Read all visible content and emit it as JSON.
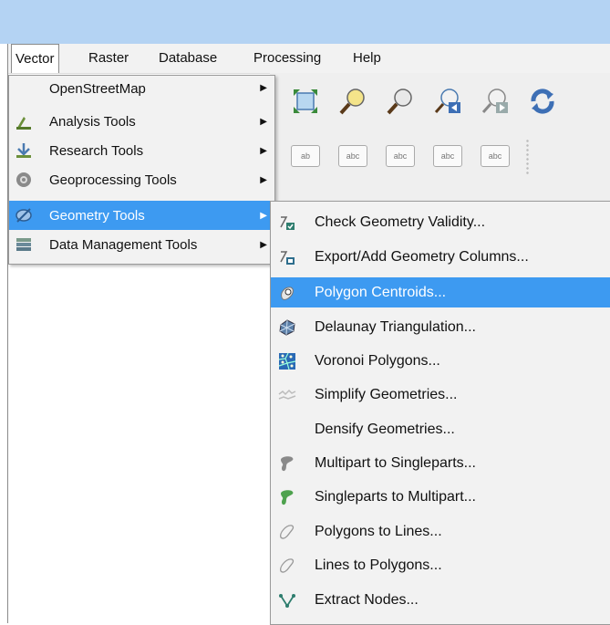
{
  "menubar": [
    "Vector",
    "Raster",
    "Database",
    "Processing",
    "Help"
  ],
  "vector_menu": [
    {
      "label": "OpenStreetMap",
      "icon": "openstreetmap-icon",
      "submenu": true
    },
    {
      "label": "Analysis Tools",
      "icon": "analysis-tools-icon",
      "submenu": true
    },
    {
      "label": "Research Tools",
      "icon": "research-tools-icon",
      "submenu": true
    },
    {
      "label": "Geoprocessing Tools",
      "icon": "geoprocessing-tools-icon",
      "submenu": true
    },
    {
      "label": "Geometry Tools",
      "icon": "geometry-tools-icon",
      "submenu": true,
      "highlighted": true
    },
    {
      "label": "Data Management Tools",
      "icon": "data-management-icon",
      "submenu": true
    }
  ],
  "toolbar_labels": [
    "ab",
    "abc",
    "abc",
    "abc",
    "abc"
  ],
  "geometry_menu": [
    {
      "label": "Check Geometry Validity...",
      "icon": "check-geometry-icon"
    },
    {
      "label": "Export/Add Geometry Columns...",
      "icon": "export-geometry-icon"
    },
    {
      "label": "Polygon Centroids...",
      "icon": "polygon-centroids-icon",
      "highlighted": true
    },
    {
      "label": "Delaunay Triangulation...",
      "icon": "delaunay-icon"
    },
    {
      "label": "Voronoi Polygons...",
      "icon": "voronoi-icon"
    },
    {
      "label": "Simplify Geometries...",
      "icon": "simplify-icon"
    },
    {
      "label": "Densify Geometries...",
      "icon": ""
    },
    {
      "label": "Multipart to Singleparts...",
      "icon": "multipart-icon"
    },
    {
      "label": "Singleparts to Multipart...",
      "icon": "singleparts-icon"
    },
    {
      "label": "Polygons to Lines...",
      "icon": "polygons-to-lines-icon"
    },
    {
      "label": "Lines to Polygons...",
      "icon": "lines-to-polygons-icon"
    },
    {
      "label": "Extract Nodes...",
      "icon": "extract-nodes-icon"
    }
  ],
  "colors": {
    "highlight": "#3d9af1",
    "titlebar": "#b4d3f3"
  }
}
